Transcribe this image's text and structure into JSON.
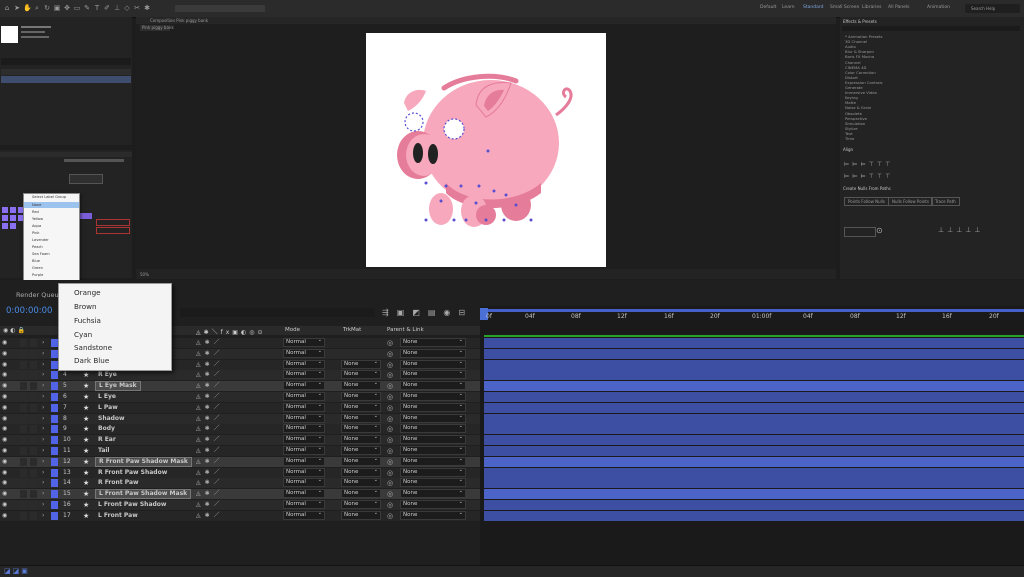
{
  "app": {
    "workspaces": [
      "Default",
      "Learn",
      "Standard",
      "Small Screen",
      "Libraries",
      "All Panels",
      "Animation",
      "Essential Graphics"
    ],
    "active_workspace": "Standard",
    "search_placeholder": "Search Help"
  },
  "comp_viewer": {
    "tab_label": "Composition Pink piggy bank",
    "sub_tab": "Pink piggy bank",
    "zoom": "50%"
  },
  "effects_panel": {
    "title": "Effects & Presets",
    "items": [
      "* Animation Presets",
      "3D Channel",
      "Audio",
      "Blur & Sharpen",
      "Boris FX Mocha",
      "Channel",
      "CINEMA 4D",
      "Color Correction",
      "Distort",
      "Expression Controls",
      "Generate",
      "Immersive Video",
      "Keying",
      "Matte",
      "Noise & Grain",
      "Obsolete",
      "Perspective",
      "Simulation",
      "Stylize",
      "Text",
      "Time"
    ]
  },
  "align_panel": {
    "title": "Align"
  },
  "create_nulls_panel": {
    "title": "Create Nulls From Paths",
    "buttons": [
      "Points Follow Nulls",
      "Nulls Follow Points",
      "Trace Path"
    ]
  },
  "label_menu": {
    "items": [
      "Select Label Group",
      "None",
      "Red",
      "Yellow",
      "Aqua",
      "Pink",
      "Lavender",
      "Peach",
      "Sea Foam",
      "Blue",
      "Green",
      "Purple",
      "Orange"
    ]
  },
  "color_menu": {
    "items": [
      "Orange",
      "Brown",
      "Fuchsia",
      "Cyan",
      "Sandstone",
      "Dark Blue"
    ]
  },
  "timeline": {
    "render_queue_label": "Render Queue",
    "timecode": "0:00:00:00",
    "columns": {
      "mode": "Mode",
      "trkmat": "TrkMat",
      "parent": "Parent & Link"
    },
    "ruler_labels": [
      "0f",
      "04f",
      "08f",
      "12f",
      "16f",
      "20f",
      "01:00f",
      "04f",
      "08f",
      "12f",
      "16f",
      "20f"
    ],
    "layers": [
      {
        "num": "",
        "name": "",
        "mode": "Normal",
        "trkmat": "",
        "parent": "None"
      },
      {
        "num": "",
        "name": "",
        "mode": "Normal",
        "trkmat": "",
        "parent": "None"
      },
      {
        "num": "",
        "name": "",
        "mode": "Normal",
        "trkmat": "None",
        "parent": "None"
      },
      {
        "num": "4",
        "name": "R Eye",
        "mode": "Normal",
        "trkmat": "None",
        "parent": "None"
      },
      {
        "num": "5",
        "name": "L Eye Mask",
        "mode": "Normal",
        "trkmat": "None",
        "parent": "None"
      },
      {
        "num": "6",
        "name": "L Eye",
        "mode": "Normal",
        "trkmat": "None",
        "parent": "None"
      },
      {
        "num": "7",
        "name": "L Paw",
        "mode": "Normal",
        "trkmat": "None",
        "parent": "None"
      },
      {
        "num": "8",
        "name": "Shadow",
        "mode": "Normal",
        "trkmat": "None",
        "parent": "None"
      },
      {
        "num": "9",
        "name": "Body",
        "mode": "Normal",
        "trkmat": "None",
        "parent": "None"
      },
      {
        "num": "10",
        "name": "R Ear",
        "mode": "Normal",
        "trkmat": "None",
        "parent": "None"
      },
      {
        "num": "11",
        "name": "Tail",
        "mode": "Normal",
        "trkmat": "None",
        "parent": "None"
      },
      {
        "num": "12",
        "name": "R Front Paw Shadow Mask",
        "mode": "Normal",
        "trkmat": "None",
        "parent": "None"
      },
      {
        "num": "13",
        "name": "R Front Paw Shadow",
        "mode": "Normal",
        "trkmat": "None",
        "parent": "None"
      },
      {
        "num": "14",
        "name": "R Front Paw",
        "mode": "Normal",
        "trkmat": "None",
        "parent": "None"
      },
      {
        "num": "15",
        "name": "L Front Paw Shadow Mask",
        "mode": "Normal",
        "trkmat": "None",
        "parent": "None"
      },
      {
        "num": "16",
        "name": "L Front Paw Shadow",
        "mode": "Normal",
        "trkmat": "None",
        "parent": "None"
      },
      {
        "num": "17",
        "name": "L Front Paw",
        "mode": "Normal",
        "trkmat": "None",
        "parent": "None"
      }
    ]
  },
  "colors": {
    "label_blue": "#5164e6",
    "track": "#3c4fa3",
    "pig": "#f7a8bd",
    "pig_dark": "#e57c9a",
    "accent": "#7fa7e0"
  }
}
